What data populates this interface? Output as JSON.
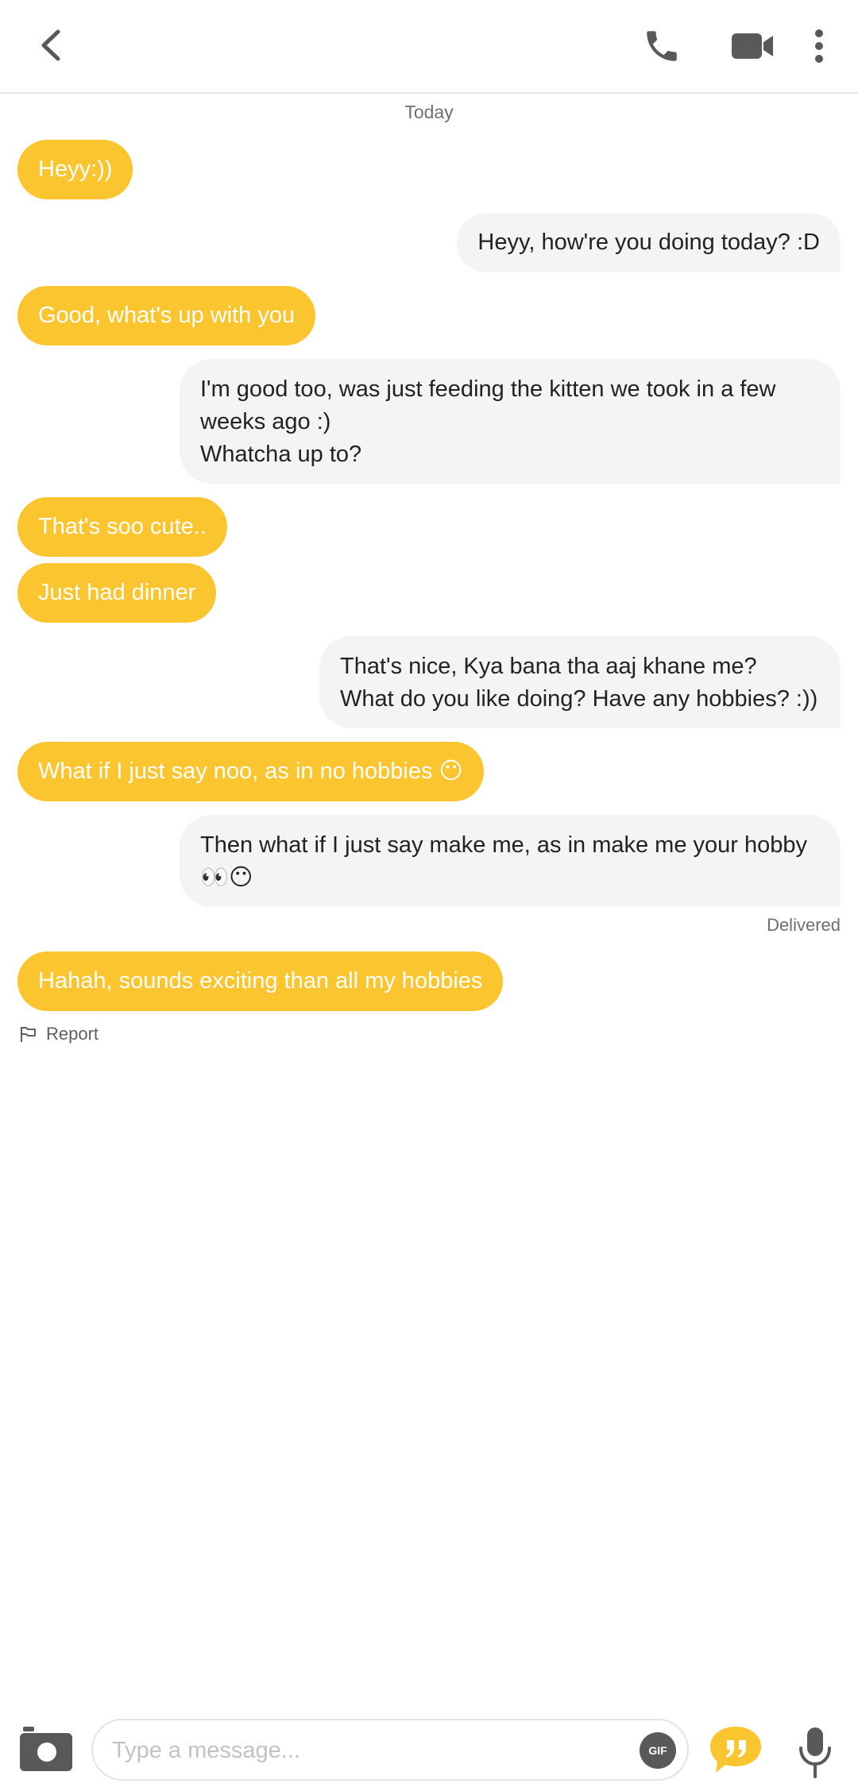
{
  "colors": {
    "accent": "#fbc52f",
    "incoming_text": "#ffffff",
    "outgoing_bg": "#f4f4f4",
    "icon_gray": "#595959"
  },
  "header": {
    "icons": [
      "back-arrow-icon",
      "phone-icon",
      "video-camera-icon",
      "more-vertical-icon"
    ]
  },
  "day_label": "Today",
  "messages": [
    {
      "from": "them",
      "text": "Heyy:))"
    },
    {
      "from": "me",
      "text": "Heyy, how're you doing today? :D"
    },
    {
      "from": "them",
      "text": "Good, what's up with you"
    },
    {
      "from": "me",
      "text": "I'm good too, was just feeding the kitten we took in a few\nweeks ago :)\nWhatcha up to?"
    },
    {
      "from": "them",
      "text": "That's soo cute.."
    },
    {
      "from": "them",
      "text": "Just had dinner"
    },
    {
      "from": "me",
      "text": "That's nice, Kya bana tha aaj khane me?\nWhat do you like doing? Have any hobbies? :))"
    },
    {
      "from": "them",
      "text": "What if I just say noo, as in no hobbies 😶"
    },
    {
      "from": "me",
      "text": "Then what if I just say make me, as in make me your hobby\n👀😶"
    },
    {
      "from": "them",
      "text": "Hahah, sounds exciting than all my hobbies"
    }
  ],
  "status": "Delivered",
  "report_label": "Report",
  "composer": {
    "placeholder": "Type a message...",
    "gif_label": "GIF",
    "icons": [
      "camera-icon",
      "quote-icon",
      "microphone-icon"
    ]
  }
}
